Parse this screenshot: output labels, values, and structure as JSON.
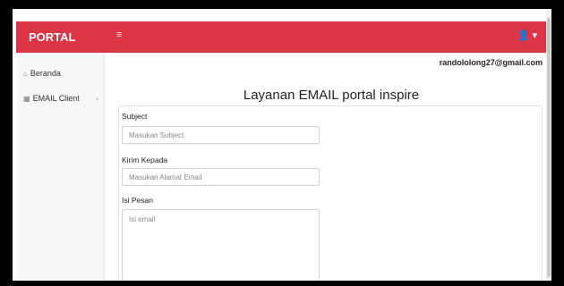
{
  "app": {
    "brand": "PORTAL",
    "hamburger_icon": "≡",
    "user_icon": "👤 ▾"
  },
  "sidebar": {
    "items": [
      {
        "label": "Beranda",
        "icon": "home-icon",
        "glyph": "⌂"
      },
      {
        "label": "EMAIL Client",
        "icon": "grid-icon",
        "glyph": "▦",
        "chevron": "›"
      }
    ]
  },
  "header": {
    "user_email": "randololong27@gmail.com"
  },
  "main": {
    "title": "Layanan EMAIL portal inspire",
    "form": {
      "subject": {
        "label": "Subject",
        "placeholder": "Masukan Subject"
      },
      "recipient": {
        "label": "Kirim Kepada",
        "placeholder": "Masukan Alamat Email"
      },
      "message": {
        "label": "Isi Pesan",
        "placeholder": "Isi email"
      }
    }
  },
  "colors": {
    "accent": "#dc3545"
  }
}
